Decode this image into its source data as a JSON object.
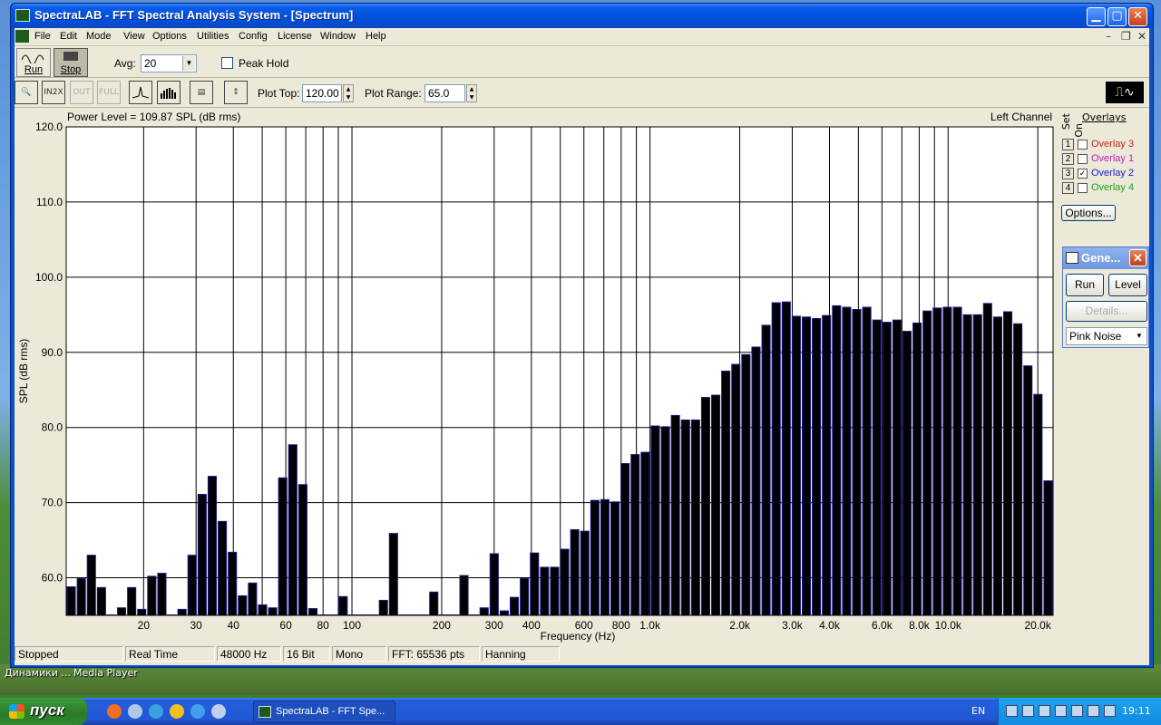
{
  "window": {
    "title": "SpectraLAB - FFT Spectral Analysis System - [Spectrum]",
    "minimize": "▁",
    "maximize": "▢",
    "close": "✕"
  },
  "menu": [
    "File",
    "Edit",
    "Mode",
    "View",
    "Options",
    "Utilities",
    "Config",
    "License",
    "Window",
    "Help"
  ],
  "mdi": {
    "min": "–",
    "restore": "❐",
    "close": "✕"
  },
  "toolbar": {
    "run_label": "Run",
    "stop_label": "Stop",
    "avg_label": "Avg:",
    "avg_value": "20",
    "peak_hold_label": "Peak Hold",
    "plot_top_label": "Plot Top:",
    "plot_top_value": "120.00",
    "plot_range_label": "Plot Range:",
    "plot_range_value": "65.0"
  },
  "plot": {
    "power_level": "Power Level = 109.87 SPL (dB rms)",
    "channel": "Left Channel"
  },
  "overlays": {
    "header": "Overlays",
    "set_label": "Set",
    "on_label": "On",
    "items": [
      {
        "num": "1",
        "label": "Overlay 3",
        "checked": false,
        "color": "#d02020"
      },
      {
        "num": "2",
        "label": "Overlay 1",
        "checked": false,
        "color": "#c020c0"
      },
      {
        "num": "3",
        "label": "Overlay 2",
        "checked": true,
        "color": "#2020c0"
      },
      {
        "num": "4",
        "label": "Overlay 4",
        "checked": false,
        "color": "#20a020"
      }
    ],
    "options_label": "Options..."
  },
  "generator": {
    "title": "Gene...",
    "run_label": "Run",
    "level_label": "Level",
    "details_label": "Details...",
    "signal": "Pink Noise"
  },
  "status": [
    "Stopped",
    "Real Time",
    "48000 Hz",
    "16 Bit",
    "Mono",
    "FFT: 65536 pts",
    "Hanning"
  ],
  "desktop": {
    "label1": "Динамики ...",
    "label2": "Media Player"
  },
  "taskbar": {
    "start_label": "пуск",
    "task_label": "SpectraLAB - FFT Spe...",
    "lang": "EN",
    "clock": "19:11"
  },
  "chart_data": {
    "type": "bar",
    "xlabel": "Frequency (Hz)",
    "ylabel": "SPL (dB rms)",
    "ylim": [
      55,
      120
    ],
    "x_scale": "log",
    "xlim": [
      11,
      22500
    ],
    "y_ticks": [
      "120.0",
      "110.0",
      "100.0",
      "90.0",
      "80.0",
      "70.0",
      "60.0"
    ],
    "x_ticks": [
      {
        "f": 20,
        "label": "20"
      },
      {
        "f": 30,
        "label": "30"
      },
      {
        "f": 40,
        "label": "40"
      },
      {
        "f": 60,
        "label": "60"
      },
      {
        "f": 80,
        "label": "80"
      },
      {
        "f": 100,
        "label": "100"
      },
      {
        "f": 200,
        "label": "200"
      },
      {
        "f": 300,
        "label": "300"
      },
      {
        "f": 400,
        "label": "400"
      },
      {
        "f": 600,
        "label": "600"
      },
      {
        "f": 800,
        "label": "800"
      },
      {
        "f": 1000,
        "label": "1.0k"
      },
      {
        "f": 2000,
        "label": "2.0k"
      },
      {
        "f": 3000,
        "label": "3.0k"
      },
      {
        "f": 4000,
        "label": "4.0k"
      },
      {
        "f": 6000,
        "label": "6.0k"
      },
      {
        "f": 8000,
        "label": "8.0k"
      },
      {
        "f": 10000,
        "label": "10.0k"
      },
      {
        "f": 20000,
        "label": "20.0k"
      }
    ],
    "grid_lines": [
      20,
      30,
      40,
      50,
      60,
      70,
      80,
      90,
      100,
      200,
      300,
      400,
      500,
      600,
      700,
      800,
      900,
      1000,
      2000,
      3000,
      4000,
      5000,
      6000,
      7000,
      8000,
      9000,
      10000,
      20000
    ],
    "values": [
      58.8,
      59.9,
      63.0,
      58.7,
      55.0,
      56.0,
      58.7,
      55.8,
      60.2,
      60.6,
      55.0,
      55.8,
      63.0,
      71.1,
      73.5,
      67.5,
      63.4,
      57.6,
      59.3,
      56.4,
      56.0,
      73.3,
      77.7,
      72.4,
      55.9,
      55.0,
      55.0,
      57.5,
      55.0,
      55.0,
      55.0,
      57.0,
      65.9,
      55.0,
      55.0,
      55.0,
      58.1,
      55.0,
      55.0,
      60.3,
      55.0,
      56.0,
      63.2,
      55.6,
      57.4,
      59.9,
      63.3,
      61.4,
      61.4,
      63.8,
      66.4,
      66.2,
      70.3,
      70.4,
      70.1,
      75.2,
      76.4,
      76.7,
      80.2,
      80.1,
      81.6,
      81.0,
      81.0,
      84.0,
      84.3,
      87.5,
      88.4,
      89.7,
      90.7,
      93.6,
      96.6,
      96.7,
      94.8,
      94.7,
      94.5,
      94.9,
      96.2,
      96.0,
      95.7,
      96.0,
      94.3,
      94.0,
      94.3,
      92.8,
      93.9,
      95.5,
      95.9,
      96.0,
      96.0,
      95.0,
      95.0,
      96.5,
      94.7,
      95.4,
      93.8,
      88.2,
      84.4,
      72.9
    ]
  }
}
